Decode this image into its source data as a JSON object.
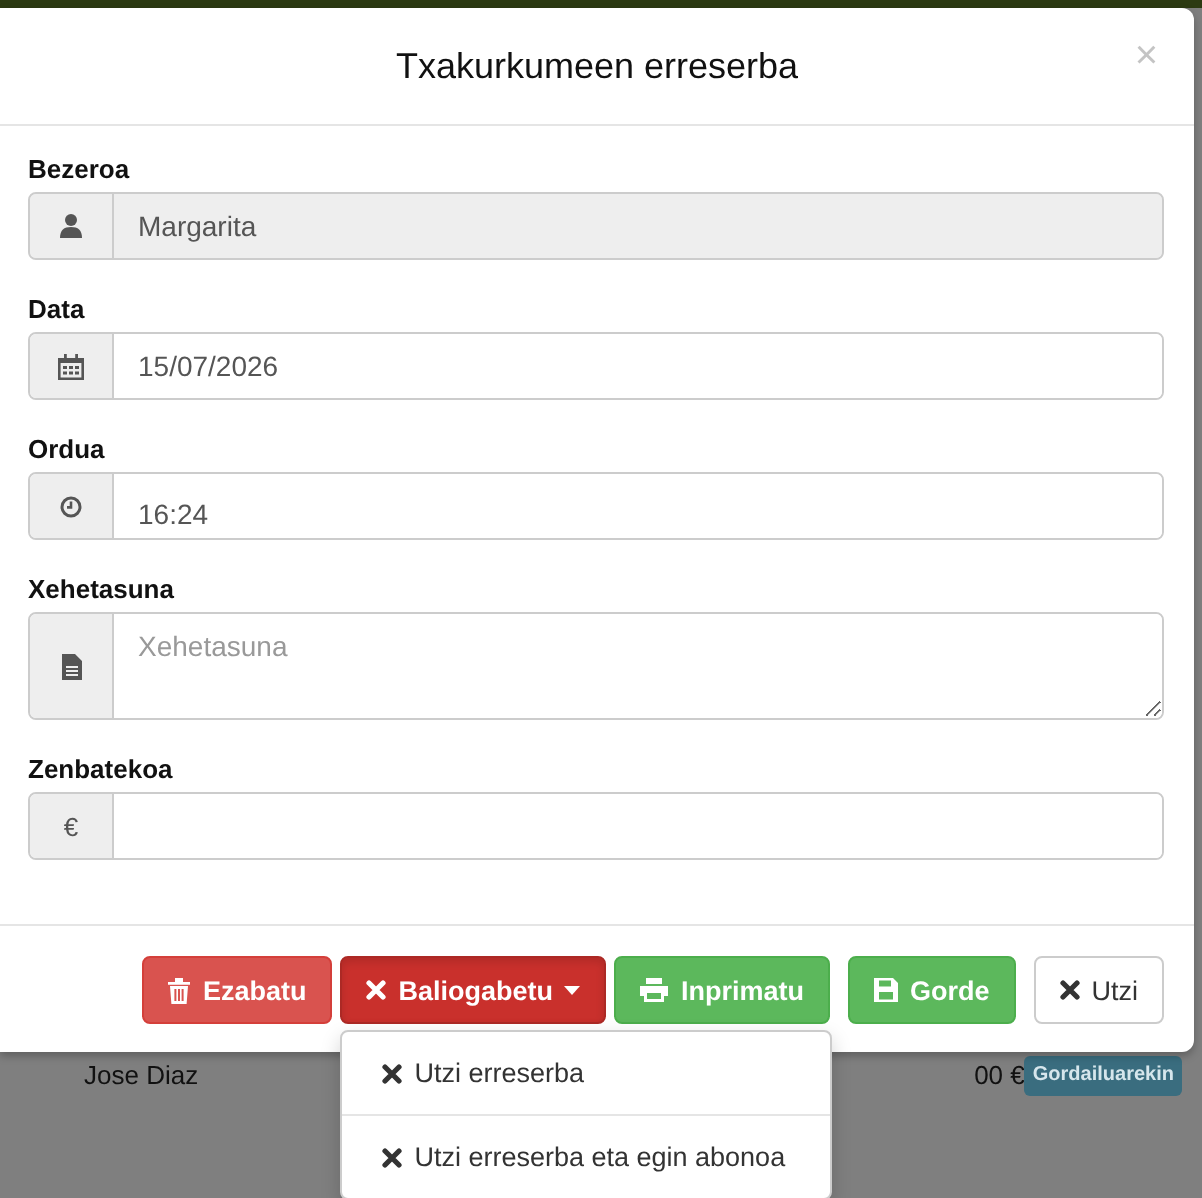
{
  "background": {
    "row": {
      "name": "Jose Diaz",
      "amount": "00 €",
      "badge": "Gordailuarekin"
    }
  },
  "dialog": {
    "title": "Txakurkumeen erreserba",
    "close": "×",
    "fields": [
      {
        "label": "Bezeroa",
        "kind": "input",
        "addon": {
          "kind": "user"
        },
        "value": "Margarita",
        "disabled": true
      },
      {
        "label": "Data",
        "kind": "input",
        "addon": {
          "kind": "calendar"
        },
        "value": "15/07/2026",
        "disabled": false
      },
      {
        "label": "Ordua",
        "kind": "time",
        "addon": {
          "kind": "clock"
        },
        "value": "16:24",
        "disabled": false
      },
      {
        "label": "Xehetasuna",
        "kind": "textarea",
        "addon": {
          "kind": "document"
        },
        "placeholder": "Xehetasuna",
        "disabled": false
      },
      {
        "label": "Zenbatekoa",
        "kind": "input",
        "addon": {
          "kind": "text",
          "text": "€"
        },
        "disabled": false
      }
    ],
    "buttons": [
      {
        "label": "Ezabatu",
        "kind": "delete"
      },
      {
        "label": "Baliogabetu",
        "kind": "invalidate",
        "menu": {
          "expanded": true,
          "items": [
            {
              "label": "Utzi erreserba"
            },
            {
              "label": "Utzi erreserba eta egin abonoa"
            }
          ]
        }
      },
      {
        "label": "Inprimatu",
        "kind": "print"
      },
      {
        "label": "Gorde",
        "kind": "save"
      },
      {
        "label": "Utzi",
        "kind": "cancel"
      }
    ]
  }
}
